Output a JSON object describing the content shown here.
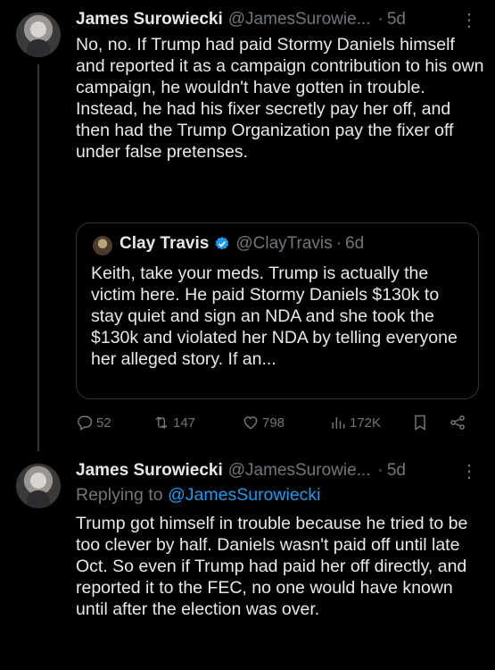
{
  "tweet1": {
    "name": "James Surowiecki",
    "handle": "@JamesSurowie...",
    "dot": "·",
    "time": "5d",
    "more": "⋮",
    "text": "No, no. If Trump had paid Stormy Daniels himself and reported it as a campaign contribution to his own campaign, he wouldn't have gotten in trouble. Instead, he had his fixer secretly pay her off, and then had the Trump Organization pay the fixer off under false pretenses.",
    "quote": {
      "name": "Clay Travis",
      "handle": "@ClayTravis",
      "dot": "·",
      "time": "6d",
      "text": "Keith, take your meds. Trump is actually the victim here. He paid Stormy Daniels $130k to stay quiet and sign an NDA and she took the $130k and violated her NDA by telling everyone her alleged story. If an..."
    },
    "actions": {
      "replies": "52",
      "reposts": "147",
      "likes": "798",
      "views": "172K"
    }
  },
  "tweet2": {
    "name": "James Surowiecki",
    "handle": "@JamesSurowie...",
    "dot": "·",
    "time": "5d",
    "more": "⋮",
    "replying_prefix": "Replying to ",
    "replying_handle": "@JamesSurowiecki",
    "text": "Trump got himself in trouble because he tried to be too clever by half. Daniels wasn't paid off until late Oct. So even if Trump had paid her off directly, and reported it to the FEC, no one would have known until after the election was over."
  },
  "colors": {
    "accent": "#1d9bf0",
    "muted": "#71767b",
    "border": "#2f3336"
  }
}
